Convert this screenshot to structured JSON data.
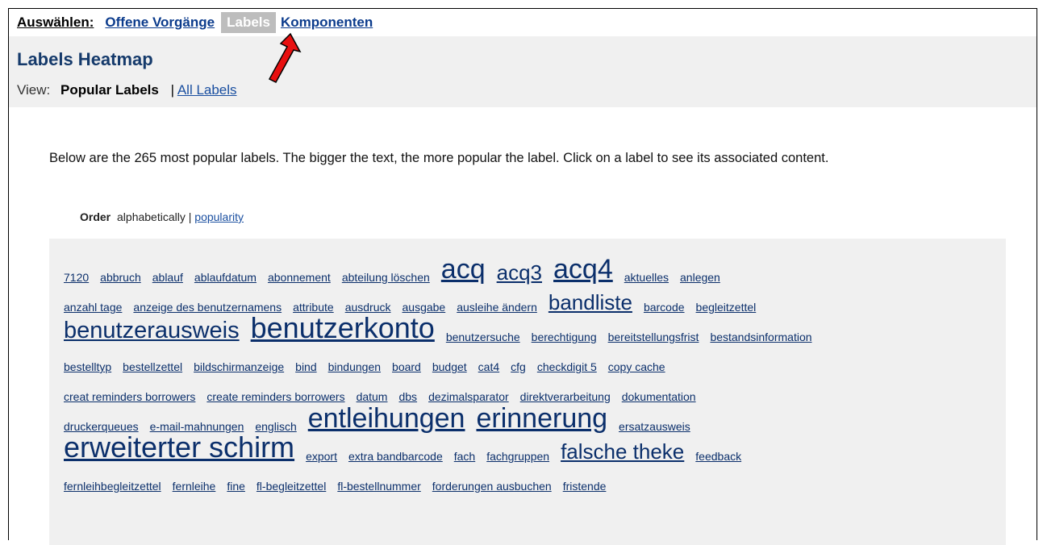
{
  "nav": {
    "select_label": "Auswählen:",
    "items": [
      {
        "label": "Offene Vorgänge",
        "active": false
      },
      {
        "label": "Labels",
        "active": true
      },
      {
        "label": "Komponenten",
        "active": false
      }
    ]
  },
  "header": {
    "title": "Labels Heatmap",
    "view_label": "View:",
    "current_view": "Popular Labels",
    "separator": "|",
    "other_view": "All Labels"
  },
  "intro_text": "Below are the 265 most popular labels. The bigger the text, the more popular the label. Click on a label to see its associated content.",
  "order": {
    "label": "Order",
    "current": "alphabetically |",
    "other": "popularity"
  },
  "cloud_rows": [
    [
      {
        "text": "7120",
        "size": 1
      },
      {
        "text": "abbruch",
        "size": 1
      },
      {
        "text": "ablauf",
        "size": 1
      },
      {
        "text": "ablaufdatum",
        "size": 1
      },
      {
        "text": "abonnement",
        "size": 1
      },
      {
        "text": "abteilung löschen",
        "size": 1
      },
      {
        "text": "acq",
        "size": 3
      },
      {
        "text": "acq3",
        "size": 2
      },
      {
        "text": "acq4",
        "size": 3
      },
      {
        "text": "aktuelles",
        "size": 1
      },
      {
        "text": "anlegen",
        "size": 1
      }
    ],
    [
      {
        "text": "anzahl tage",
        "size": 1
      },
      {
        "text": "anzeige des benutzernamens",
        "size": 1
      },
      {
        "text": "attribute",
        "size": 1
      },
      {
        "text": "ausdruck",
        "size": 1
      },
      {
        "text": "ausgabe",
        "size": 1
      },
      {
        "text": "ausleihe ändern",
        "size": 1
      },
      {
        "text": "bandliste",
        "size": 2
      },
      {
        "text": "barcode",
        "size": 1
      },
      {
        "text": "begleitzettel",
        "size": 1
      }
    ],
    [
      {
        "text": "benutzerausweis",
        "size": 4
      },
      {
        "text": "benutzerkonto",
        "size": 5
      },
      {
        "text": "benutzersuche",
        "size": 1
      },
      {
        "text": "berechtigung",
        "size": 1
      },
      {
        "text": "bereitstellungsfrist",
        "size": 1
      },
      {
        "text": "bestandsinformation",
        "size": 1
      }
    ],
    [
      {
        "text": "bestelltyp",
        "size": 1
      },
      {
        "text": "bestellzettel",
        "size": 1
      },
      {
        "text": "bildschirmanzeige",
        "size": 1
      },
      {
        "text": "bind",
        "size": 1
      },
      {
        "text": "bindungen",
        "size": 1
      },
      {
        "text": "board",
        "size": 1
      },
      {
        "text": "budget",
        "size": 1
      },
      {
        "text": "cat4",
        "size": 1
      },
      {
        "text": "cfg",
        "size": 1
      },
      {
        "text": "checkdigit 5",
        "size": 1
      },
      {
        "text": "copy cache",
        "size": 1
      }
    ],
    [
      {
        "text": "creat reminders borrowers",
        "size": 1
      },
      {
        "text": "create reminders borrowers",
        "size": 1
      },
      {
        "text": "datum",
        "size": 1
      },
      {
        "text": "dbs",
        "size": 1
      },
      {
        "text": "dezimalsparator",
        "size": 1
      },
      {
        "text": "direktverarbeitung",
        "size": 1
      },
      {
        "text": "dokumentation",
        "size": 1
      }
    ],
    [
      {
        "text": "druckerqueues",
        "size": 1
      },
      {
        "text": "e-mail-mahnungen",
        "size": 1
      },
      {
        "text": "englisch",
        "size": 1
      },
      {
        "text": "entleihungen",
        "size": 3
      },
      {
        "text": "erinnerung",
        "size": 3
      },
      {
        "text": "ersatzausweis",
        "size": 1
      }
    ],
    [
      {
        "text": "erweiterter schirm",
        "size": 5
      },
      {
        "text": "export",
        "size": 1
      },
      {
        "text": "extra bandbarcode",
        "size": 1
      },
      {
        "text": "fach",
        "size": 1
      },
      {
        "text": "fachgruppen",
        "size": 1
      },
      {
        "text": "falsche theke",
        "size": 2
      },
      {
        "text": "feedback",
        "size": 1
      }
    ],
    [
      {
        "text": "fernleihbegleitzettel",
        "size": 1
      },
      {
        "text": "fernleihe",
        "size": 1
      },
      {
        "text": "fine",
        "size": 1
      },
      {
        "text": "fl-begleitzettel",
        "size": 1
      },
      {
        "text": "fl-bestellnummer",
        "size": 1
      },
      {
        "text": "forderungen ausbuchen",
        "size": 1
      },
      {
        "text": "fristende",
        "size": 1
      }
    ]
  ]
}
